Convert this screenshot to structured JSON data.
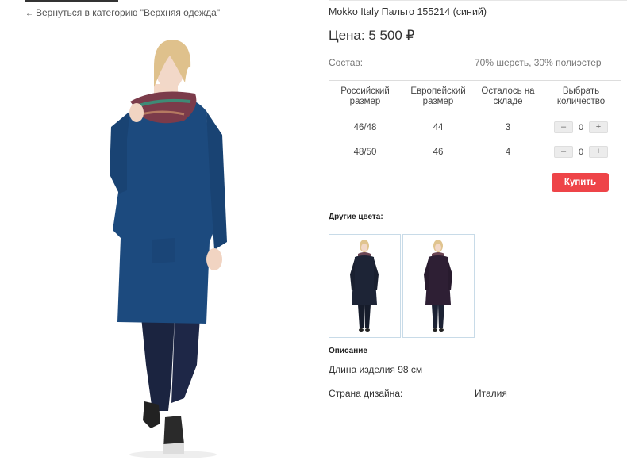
{
  "nav": {
    "back_arrow": "←",
    "back_label": "Вернуться в категорию \"Верхняя одежда\""
  },
  "product": {
    "title": "Mokko Italy Пальто 155214 (синий)",
    "price": "Цена: 5 500 ₽",
    "composition_label": "Состав:",
    "composition_value": "70% шерсть, 30% полиэстер"
  },
  "sizes_table": {
    "headers": [
      "Российский размер",
      "Европейский размер",
      "Осталось на складе",
      "Выбрать количество"
    ],
    "rows": [
      {
        "ru": "46/48",
        "eu": "44",
        "stock": "3",
        "qty": "0"
      },
      {
        "ru": "48/50",
        "eu": "46",
        "stock": "4",
        "qty": "0"
      }
    ],
    "minus_label": "–",
    "plus_label": "+"
  },
  "buy_label": "Купить",
  "other_colors": {
    "title": "Другие цвета:"
  },
  "description": {
    "title": "Описание",
    "text": "Длина изделия 98 см",
    "country_label": "Страна дизайна:",
    "country_value": "Италия"
  },
  "colors": {
    "accent": "#ee4448",
    "coat_main": "#1c4a7e",
    "coat_alt_1": "#1d2436",
    "coat_alt_2": "#2e1f34"
  }
}
